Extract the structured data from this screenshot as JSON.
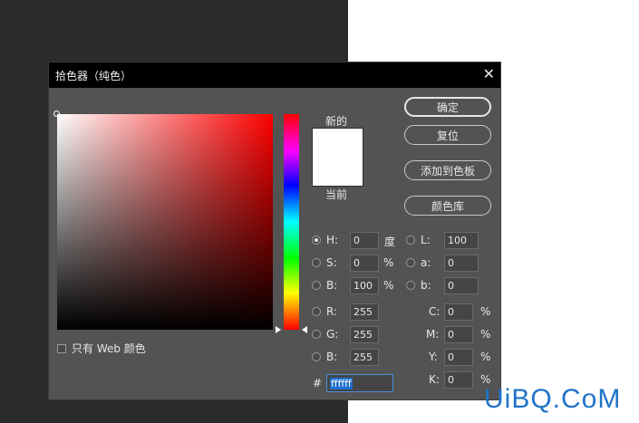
{
  "dialog": {
    "title": "拾色器（纯色）",
    "close": "✕"
  },
  "preview": {
    "new_label": "新的",
    "current_label": "当前",
    "color": "#ffffff"
  },
  "buttons": {
    "ok": "确定",
    "reset": "复位",
    "add_to_swatches": "添加到色板",
    "color_libraries": "颜色库"
  },
  "web_only": {
    "label": "只有 Web 颜色",
    "checked": false
  },
  "hsb": {
    "h": {
      "label": "H:",
      "value": "0",
      "unit": "度",
      "selected": true
    },
    "s": {
      "label": "S:",
      "value": "0",
      "unit": "%"
    },
    "b": {
      "label": "B:",
      "value": "100",
      "unit": "%"
    }
  },
  "rgb": {
    "r": {
      "label": "R:",
      "value": "255"
    },
    "g": {
      "label": "G:",
      "value": "255"
    },
    "b": {
      "label": "B:",
      "value": "255"
    }
  },
  "lab": {
    "l": {
      "label": "L:",
      "value": "100"
    },
    "a": {
      "label": "a:",
      "value": "0"
    },
    "b": {
      "label": "b:",
      "value": "0"
    }
  },
  "cmyk": {
    "c": {
      "label": "C:",
      "value": "0",
      "unit": "%"
    },
    "m": {
      "label": "M:",
      "value": "0",
      "unit": "%"
    },
    "y": {
      "label": "Y:",
      "value": "0",
      "unit": "%"
    },
    "k": {
      "label": "K:",
      "value": "0",
      "unit": "%"
    }
  },
  "hex": {
    "label": "#",
    "value": "ffffff"
  },
  "watermark": "UiBQ.CoM"
}
